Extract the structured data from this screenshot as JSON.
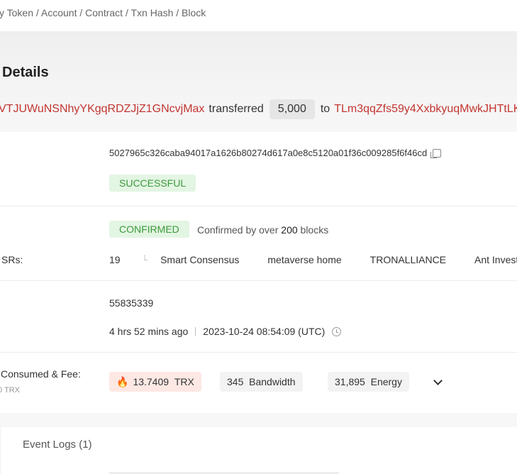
{
  "breadcrumb": "y Token / Account / Contract / Txn Hash / Block",
  "hero": {
    "title": "Details",
    "from_address": "VTJUWuNSNhyYKgqRDZJjZ1GNcvjMax",
    "transferred_label": "transferred",
    "amount": "5,000",
    "to_label": "to",
    "to_address": "TLm3qqZfs59y4XxbkyuqMwkJHTtLK"
  },
  "hash": {
    "value": "5027965c326caba94017a1626b80274d617a0e8c5120a01f36c009285f6f46cd",
    "copy_icon": "copy-icon"
  },
  "status": {
    "result": "SUCCESSFUL"
  },
  "confirmation": {
    "badge": "CONFIRMED",
    "text_prefix": "Confirmed by over",
    "count": "200",
    "text_suffix": "blocks"
  },
  "srs": {
    "label": "SRs:",
    "count": "19",
    "items": [
      "Smart Consensus",
      "metaverse home",
      "TRONALLIANCE",
      "Ant Investme"
    ]
  },
  "block": {
    "number": "55835339",
    "relative_time": "4 hrs 52 mins ago",
    "timestamp": "2023-10-24 08:54:09 (UTC)"
  },
  "fee": {
    "label": "Consumed & Fee:",
    "sub": "0 TRX",
    "trx_value": "13.7409",
    "trx_unit": "TRX",
    "bandwidth_value": "345",
    "bandwidth_unit": "Bandwidth",
    "energy_value": "31,895",
    "energy_unit": "Energy"
  },
  "tabs": {
    "event_logs": "Event Logs (1)"
  },
  "colors": {
    "address": "#c23631",
    "success": "#3a9a3a",
    "success_bg": "#e3f5e3"
  }
}
